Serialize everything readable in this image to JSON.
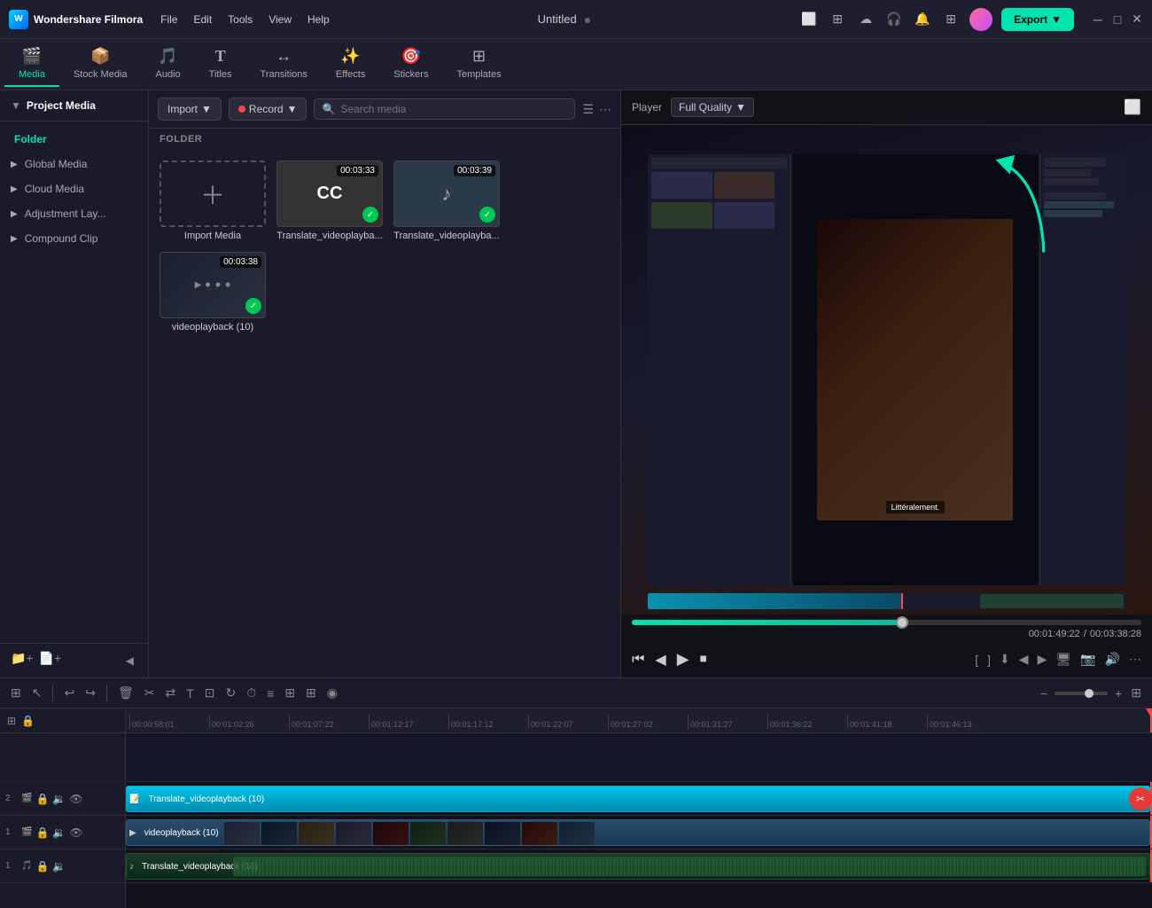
{
  "app": {
    "name": "Wondershare Filmora",
    "title": "Untitled",
    "logo_letter": "W"
  },
  "menu": {
    "items": [
      "File",
      "Edit",
      "Tools",
      "View",
      "Help"
    ]
  },
  "nav": {
    "tabs": [
      {
        "id": "media",
        "label": "Media",
        "icon": "🎬",
        "active": true
      },
      {
        "id": "stock",
        "label": "Stock Media",
        "icon": "📦",
        "active": false
      },
      {
        "id": "audio",
        "label": "Audio",
        "icon": "🎵",
        "active": false
      },
      {
        "id": "titles",
        "label": "Titles",
        "icon": "T",
        "active": false
      },
      {
        "id": "transitions",
        "label": "Transitions",
        "icon": "↔",
        "active": false
      },
      {
        "id": "effects",
        "label": "Effects",
        "icon": "✨",
        "active": false
      },
      {
        "id": "stickers",
        "label": "Stickers",
        "icon": "🎯",
        "active": false
      },
      {
        "id": "templates",
        "label": "Templates",
        "icon": "⊞",
        "active": false
      }
    ]
  },
  "sidebar": {
    "title": "Project Media",
    "folder_label": "Folder",
    "items": [
      {
        "label": "Global Media",
        "id": "global"
      },
      {
        "label": "Cloud Media",
        "id": "cloud"
      },
      {
        "label": "Adjustment Lay...",
        "id": "adjustment"
      },
      {
        "label": "Compound Clip",
        "id": "compound"
      }
    ]
  },
  "content": {
    "folder_section": "FOLDER",
    "import_label": "Import",
    "record_label": "Record",
    "search_placeholder": "Search media",
    "media_items": [
      {
        "id": "import",
        "type": "import",
        "label": "Import Media"
      },
      {
        "id": "cc1",
        "type": "cc",
        "label": "Translate_videoplayba...",
        "duration": "00:03:33",
        "checked": true
      },
      {
        "id": "music1",
        "type": "music",
        "label": "Translate_videoplayba...",
        "duration": "00:03:39",
        "checked": true
      },
      {
        "id": "video1",
        "type": "video",
        "label": "videoplayback (10)",
        "duration": "00:03:38",
        "checked": true
      }
    ]
  },
  "player": {
    "label": "Player",
    "quality": "Full Quality",
    "current_time": "00:01:49:22",
    "total_time": "00:03:38:28",
    "progress_pct": 53,
    "subtitle": "Littéralement.",
    "controls": {
      "rewind": "⏮",
      "back_frame": "◀",
      "play": "▶",
      "stop": "⏹",
      "bracket_in": "[",
      "bracket_out": "]",
      "clip_to_timeline": "⬇",
      "prev_marker": "◀",
      "next_marker": "▶",
      "screen": "📺",
      "snapshot": "📷",
      "audio": "🔊",
      "more": "⋯"
    }
  },
  "timeline": {
    "ruler_marks": [
      "00:00:58:01",
      "00:01:02:26",
      "00:01:07:22",
      "00:01:12:17",
      "00:01:17:12",
      "00:01:22:07",
      "00:01:27:02",
      "00:01:31:27",
      "00:01:36:22",
      "00:01:41:18",
      "00:01:46:13"
    ],
    "tracks": [
      {
        "num": "2",
        "type": "video",
        "label": "Translate_videoplayback (10)",
        "color": "blue"
      },
      {
        "num": "1",
        "type": "video",
        "label": "videoplayback (10)",
        "color": "dark"
      },
      {
        "num": "1",
        "type": "audio",
        "label": "Translate_videoplayback (10)",
        "color": "audio"
      }
    ]
  },
  "export": {
    "label": "Export"
  }
}
